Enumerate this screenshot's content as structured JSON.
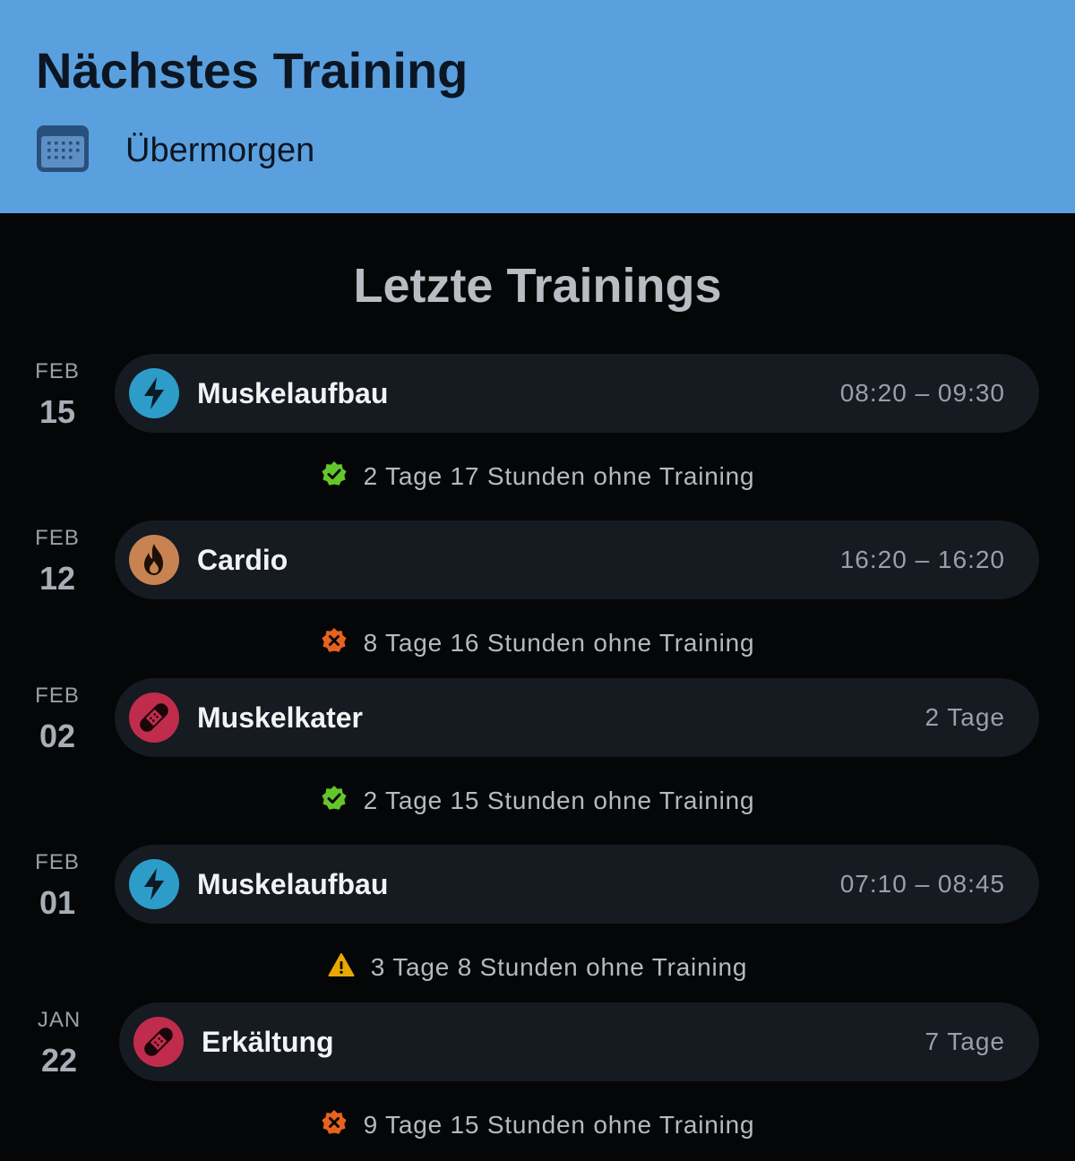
{
  "header": {
    "title": "Nächstes Training",
    "subtitle": "Übermorgen",
    "icon": "calendar-icon",
    "background": "#5ba0de"
  },
  "section": {
    "title": "Letzte Trainings"
  },
  "trainings": [
    {
      "month": "FEB",
      "day": "15",
      "name": "Muskelaufbau",
      "time": "08:20 – 09:30",
      "icon": "lightning-icon",
      "icon_color": "#2e9cc8",
      "gap": {
        "text": "2 Tage 17 Stunden ohne Training",
        "status": "good",
        "icon": "check-badge-icon",
        "color": "#63c72b"
      }
    },
    {
      "month": "FEB",
      "day": "12",
      "name": "Cardio",
      "time": "16:20 – 16:20",
      "icon": "flame-icon",
      "icon_color": "#c98353",
      "gap": {
        "text": "8 Tage 16 Stunden ohne Training",
        "status": "bad",
        "icon": "x-badge-icon",
        "color": "#e8621e"
      }
    },
    {
      "month": "FEB",
      "day": "02",
      "name": "Muskelkater",
      "time": "2 Tage",
      "icon": "bandage-icon",
      "icon_color": "#c02c4c",
      "gap": {
        "text": "2 Tage 15 Stunden ohne Training",
        "status": "good",
        "icon": "check-badge-icon",
        "color": "#63c72b"
      }
    },
    {
      "month": "FEB",
      "day": "01",
      "name": "Muskelaufbau",
      "time": "07:10 – 08:45",
      "icon": "lightning-icon",
      "icon_color": "#2e9cc8",
      "gap": {
        "text": "3 Tage 8 Stunden ohne Training",
        "status": "warning",
        "icon": "warning-icon",
        "color": "#e9a800"
      }
    },
    {
      "month": "JAN",
      "day": "22",
      "name": "Erkältung",
      "time": "7 Tage",
      "icon": "bandage-icon",
      "icon_color": "#c02c4c",
      "gap": {
        "text": "9 Tage 15 Stunden ohne Training",
        "status": "bad",
        "icon": "x-badge-icon",
        "color": "#e8621e"
      }
    }
  ]
}
